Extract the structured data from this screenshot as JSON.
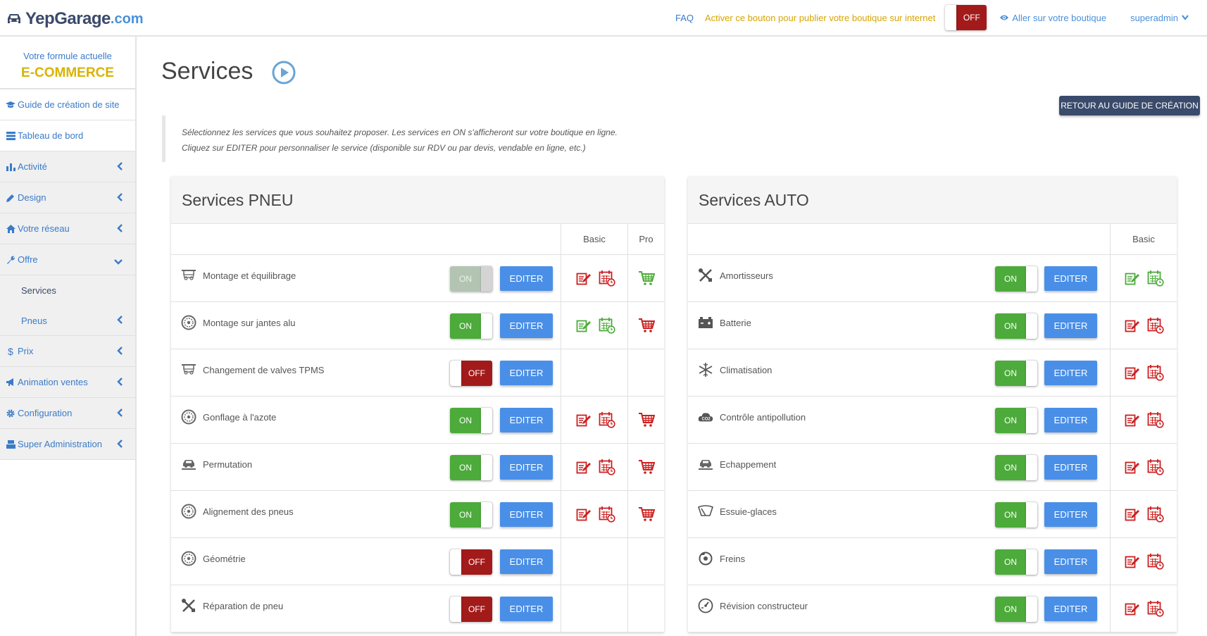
{
  "header": {
    "brand": "YepGarage",
    "brand_suffix": ".com",
    "faq": "FAQ",
    "publish_hint": "Activer ce bouton pour publier votre boutique sur internet",
    "publish_toggle": "OFF",
    "shop_link": "Aller sur votre boutique",
    "user": "superadmin"
  },
  "sidebar": {
    "plan_label": "Votre formule actuelle",
    "plan_name": "E-COMMERCE",
    "items": [
      {
        "label": "Guide de création de site",
        "icon": "graduation-cap-icon"
      },
      {
        "label": "Tableau de bord",
        "icon": "dashboard-icon"
      },
      {
        "label": "Activité",
        "icon": "bar-chart-icon"
      },
      {
        "label": "Design",
        "icon": "pencil-icon"
      },
      {
        "label": "Votre réseau",
        "icon": "home-icon"
      },
      {
        "label": "Offre",
        "icon": "wrench-icon"
      },
      {
        "label": "Services"
      },
      {
        "label": "Pneus"
      },
      {
        "label": "Prix",
        "icon": "dollar-icon"
      },
      {
        "label": "Animation ventes",
        "icon": "megaphone-icon"
      },
      {
        "label": "Configuration",
        "icon": "gear-icon"
      },
      {
        "label": "Super Administration",
        "icon": "users-icon"
      }
    ]
  },
  "page": {
    "title": "Services",
    "guide_button": "RETOUR AU GUIDE DE CRÉATION",
    "note_line1": "Sélectionnez les services que vous souhaitez proposer. Les services en ON s'afficheront sur votre boutique en ligne.",
    "note_line2": "Cliquez sur EDITER pour personnaliser le service (disponible sur RDV ou par devis, vendable en ligne, etc.)"
  },
  "colors": {
    "accent_blue": "#4a8fe7",
    "nav_blue": "#3a7bc8",
    "on_green": "#4cab3a",
    "off_red": "#a31a1a",
    "plan_gold": "#d9b300",
    "dark_navy": "#3a4a6b"
  },
  "pneu": {
    "title": "Services PNEU",
    "col_basic": "Basic",
    "col_pro": "Pro",
    "edit_label": "EDITER",
    "rows": [
      {
        "name": "Montage et équilibrage",
        "icon": "tire-lift-icon",
        "state": "ON",
        "disabled": true,
        "basic_color": "red",
        "pro_color": "green"
      },
      {
        "name": "Montage sur jantes alu",
        "icon": "wheel-icon",
        "state": "ON",
        "basic_color": "green",
        "pro_color": "red"
      },
      {
        "name": "Changement de valves TPMS",
        "icon": "tire-lift-icon",
        "state": "OFF"
      },
      {
        "name": "Gonflage à l'azote",
        "icon": "wheel-icon",
        "state": "ON",
        "basic_color": "red",
        "pro_color": "red"
      },
      {
        "name": "Permutation",
        "icon": "car-lift-icon",
        "state": "ON",
        "basic_color": "red",
        "pro_color": "red"
      },
      {
        "name": "Alignement des pneus",
        "icon": "wheel-icon",
        "state": "ON",
        "basic_color": "red",
        "pro_color": "red"
      },
      {
        "name": "Géométrie",
        "icon": "wheel-icon",
        "state": "OFF"
      },
      {
        "name": "Réparation de pneu",
        "icon": "tools-icon",
        "state": "OFF"
      }
    ]
  },
  "auto": {
    "title": "Services AUTO",
    "col_basic": "Basic",
    "edit_label": "EDITER",
    "rows": [
      {
        "name": "Amortisseurs",
        "icon": "tools-icon",
        "state": "ON",
        "basic_color": "green"
      },
      {
        "name": "Batterie",
        "icon": "battery-icon",
        "state": "ON",
        "basic_color": "red"
      },
      {
        "name": "Climatisation",
        "icon": "snowflake-icon",
        "state": "ON",
        "basic_color": "red"
      },
      {
        "name": "Contrôle antipollution",
        "icon": "co2-cloud-icon",
        "state": "ON",
        "basic_color": "red"
      },
      {
        "name": "Echappement",
        "icon": "car-lift-icon",
        "state": "ON",
        "basic_color": "red"
      },
      {
        "name": "Essuie-glaces",
        "icon": "wiper-icon",
        "state": "ON",
        "basic_color": "red"
      },
      {
        "name": "Freins",
        "icon": "brake-icon",
        "state": "ON",
        "basic_color": "red"
      },
      {
        "name": "Révision constructeur",
        "icon": "gauge-icon",
        "state": "ON",
        "basic_color": "red"
      }
    ]
  }
}
